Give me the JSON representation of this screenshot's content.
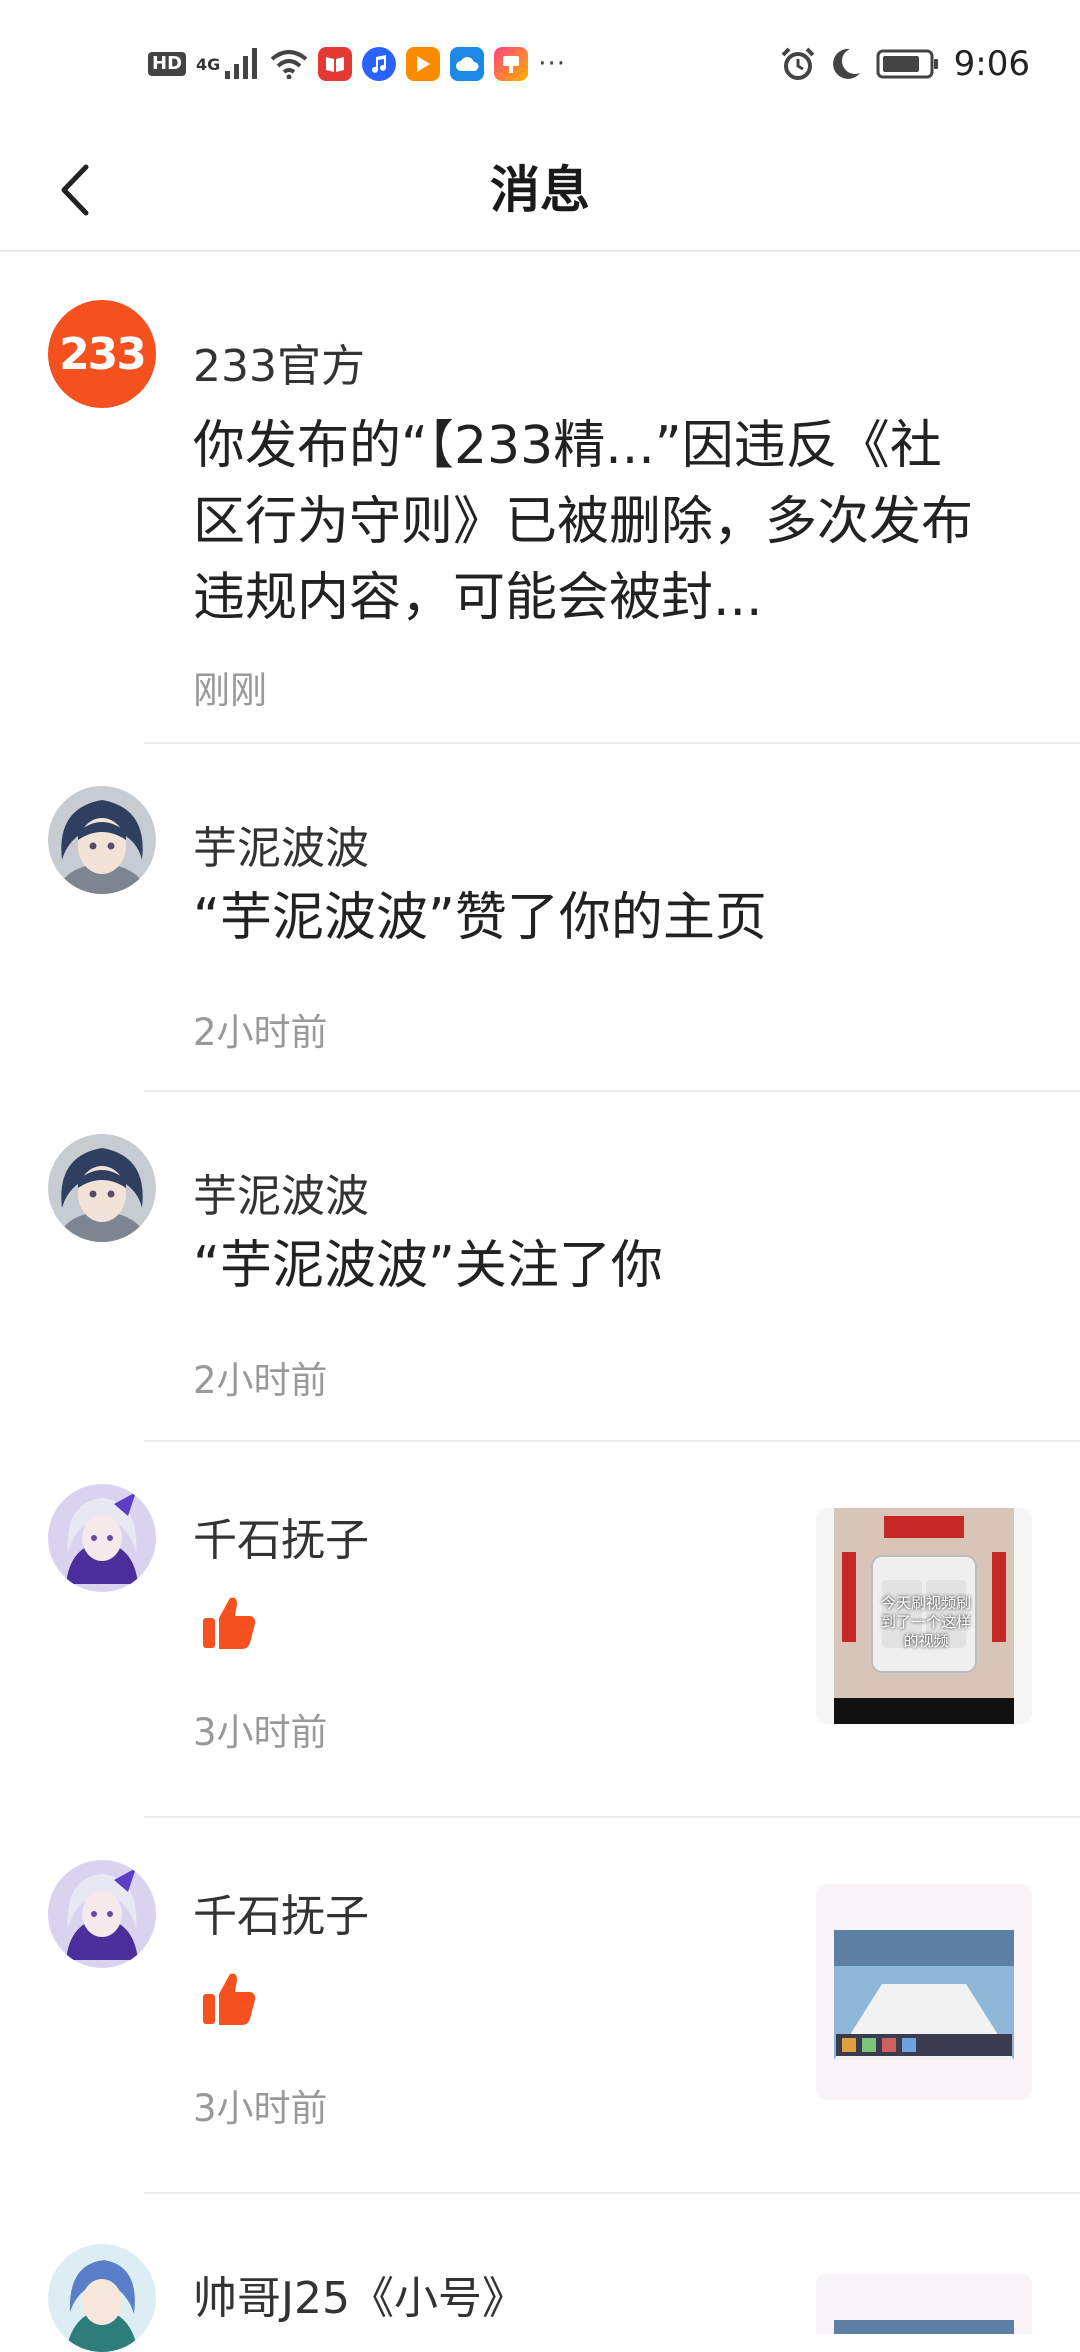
{
  "status_bar": {
    "hd": "HD",
    "network": "4G",
    "time": "9:06",
    "more": "···"
  },
  "nav": {
    "title": "消息"
  },
  "messages": [
    {
      "sender": "233官方",
      "avatar_text": "233",
      "text": "你发布的“【233精...”因违反《社区行为守则》已被删除，多次发布违规内容，可能会被封...",
      "time": "刚刚"
    },
    {
      "sender": "芋泥波波",
      "text": "“芋泥波波”赞了你的主页",
      "time": "2小时前"
    },
    {
      "sender": "芋泥波波",
      "text": "“芋泥波波”关注了你",
      "time": "2小时前"
    },
    {
      "sender": "千石抚子",
      "icon": "thumbs-up-icon",
      "time": "3小时前",
      "thumb_text": "今天刷视频刷到了一个这样的视频"
    },
    {
      "sender": "千石抚子",
      "icon": "thumbs-up-icon",
      "time": "3小时前"
    },
    {
      "sender": "帅哥J25《小号》"
    }
  ],
  "colors": {
    "accent": "#f4511e",
    "divider": "#ececec",
    "time_gray": "#999999"
  }
}
